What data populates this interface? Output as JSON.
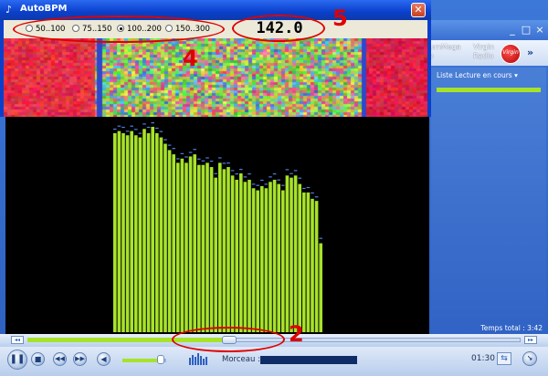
{
  "wmp": {
    "tabs": [
      "umMega",
      "Virgin",
      "Radio"
    ],
    "tab_left_fragment": "o",
    "virgin_logo_text": "Virgin",
    "playlist_label": "Liste Lecture en cours",
    "total_time": "Temps total : 3:42",
    "morceau_label": "Morceau :",
    "elapsed": "01:30",
    "window_controls": [
      "_",
      "□",
      "×"
    ],
    "colors": {
      "frame": "#3c78d8",
      "accent": "#a7e22a"
    }
  },
  "autobpm": {
    "title": "AutoBPM",
    "close_icon": "close-icon",
    "ranges": [
      {
        "label": "50..100",
        "selected": false
      },
      {
        "label": "75..150",
        "selected": false
      },
      {
        "label": "100..200",
        "selected": true
      },
      {
        "label": "150..300",
        "selected": false
      }
    ],
    "bpm_value": "142.0"
  },
  "annotations": {
    "n2": "2",
    "n4": "4",
    "n5": "5",
    "color": "#e00000"
  },
  "visualization": {
    "bar_color": "#a7e22a",
    "peak_color": "#4c7fe0",
    "levels": [
      0.94,
      0.95,
      0.94,
      0.93,
      0.95,
      0.93,
      0.92,
      0.96,
      0.94,
      0.97,
      0.94,
      0.92,
      0.89,
      0.86,
      0.84,
      0.8,
      0.82,
      0.8,
      0.83,
      0.84,
      0.79,
      0.79,
      0.8,
      0.78,
      0.73,
      0.8,
      0.77,
      0.78,
      0.74,
      0.72,
      0.75,
      0.71,
      0.72,
      0.68,
      0.67,
      0.69,
      0.68,
      0.71,
      0.72,
      0.7,
      0.67,
      0.74,
      0.73,
      0.74,
      0.7,
      0.66,
      0.66,
      0.63,
      0.62,
      0.42
    ],
    "playback_position": 0.41,
    "volume": 0.8
  }
}
